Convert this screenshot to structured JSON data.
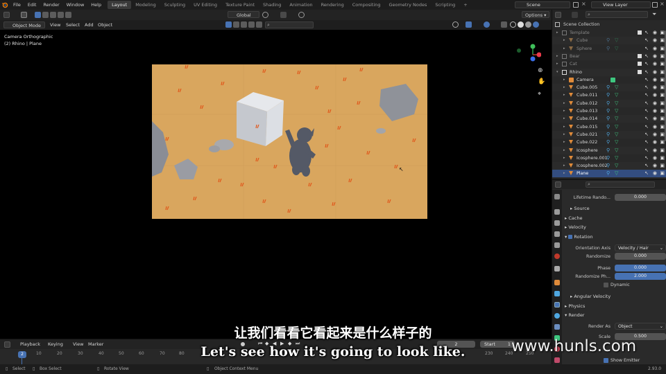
{
  "topbar": {
    "menus": [
      "File",
      "Edit",
      "Render",
      "Window",
      "Help"
    ],
    "workspaces": [
      "Layout",
      "Modeling",
      "Sculpting",
      "UV Editing",
      "Texture Paint",
      "Shading",
      "Animation",
      "Rendering",
      "Compositing",
      "Geometry Nodes",
      "Scripting"
    ],
    "active_workspace": "Layout",
    "scene": "Scene",
    "view_layer": "View Layer"
  },
  "viewport_header": {
    "mode": "Object Mode",
    "menus": [
      "View",
      "Select",
      "Add",
      "Object"
    ],
    "transform_orientation": "Global",
    "options": "Options"
  },
  "viewport": {
    "camera_label": "Camera Orthographic",
    "object_label": "(2) Rhino | Plane"
  },
  "outliner": {
    "title": "Scene Collection",
    "rows": [
      {
        "name": "Template",
        "level": 1,
        "type": "collection",
        "dim": true
      },
      {
        "name": "Cube",
        "level": 2,
        "type": "mesh",
        "dim": true
      },
      {
        "name": "Sphere",
        "level": 2,
        "type": "mesh",
        "dim": true
      },
      {
        "name": "Bear",
        "level": 1,
        "type": "collection",
        "dim": true
      },
      {
        "name": "Cat",
        "level": 1,
        "type": "collection",
        "dim": true
      },
      {
        "name": "Rhino",
        "level": 1,
        "type": "collection",
        "dim": false
      },
      {
        "name": "Camera",
        "level": 2,
        "type": "camera",
        "dim": false
      },
      {
        "name": "Cube.005",
        "level": 2,
        "type": "mesh",
        "dim": false
      },
      {
        "name": "Cube.011",
        "level": 2,
        "type": "mesh",
        "dim": false
      },
      {
        "name": "Cube.012",
        "level": 2,
        "type": "mesh",
        "dim": false
      },
      {
        "name": "Cube.013",
        "level": 2,
        "type": "mesh",
        "dim": false
      },
      {
        "name": "Cube.014",
        "level": 2,
        "type": "mesh",
        "dim": false
      },
      {
        "name": "Cube.015",
        "level": 2,
        "type": "mesh",
        "dim": false
      },
      {
        "name": "Cube.021",
        "level": 2,
        "type": "mesh",
        "dim": false
      },
      {
        "name": "Cube.022",
        "level": 2,
        "type": "mesh",
        "dim": false
      },
      {
        "name": "Icosphere",
        "level": 2,
        "type": "mesh",
        "dim": false
      },
      {
        "name": "Icosphere.001",
        "level": 2,
        "type": "mesh",
        "dim": false
      },
      {
        "name": "Icosphere.002",
        "level": 2,
        "type": "mesh",
        "dim": false
      },
      {
        "name": "Plane",
        "level": 2,
        "type": "mesh",
        "dim": false,
        "selected": true
      }
    ]
  },
  "properties": {
    "lifetime_randomness": {
      "label": "Lifetime Rando...",
      "value": "0.000"
    },
    "source": "Source",
    "cache": "Cache",
    "velocity": "Velocity",
    "rotation": "Rotation",
    "orientation_axis": {
      "label": "Orientation Axis",
      "value": "Velocity / Hair"
    },
    "randomize": {
      "label": "Randomize",
      "value": "0.000"
    },
    "phase": {
      "label": "Phase",
      "value": "0.000"
    },
    "randomize_phase": {
      "label": "Randomize Ph...",
      "value": "2.000"
    },
    "dynamic": "Dynamic",
    "angular_velocity": "Angular Velocity",
    "physics": "Physics",
    "render": "Render",
    "render_as": {
      "label": "Render As",
      "value": "Object"
    },
    "scale": {
      "label": "Scale",
      "value": "0.500"
    },
    "show_emitter": "Show Emitter"
  },
  "timeline": {
    "menus": [
      "Playback",
      "Keying",
      "View",
      "Marker"
    ],
    "current_frame": "2",
    "start_label": "Start",
    "start_value": "1",
    "ticks": [
      "2",
      "10",
      "20",
      "30",
      "40",
      "50",
      "60",
      "70",
      "80",
      "230",
      "240",
      "250"
    ]
  },
  "statusbar": {
    "select": "Select",
    "box_select": "Box Select",
    "rotate_view": "Rotate View",
    "context_menu": "Object Context Menu",
    "version": "2.93.0"
  },
  "subtitles": {
    "chinese": "让我们看看它看起来是什么样子的",
    "english": "Let's see how it's going to look like."
  },
  "watermark": "www.hunls.com",
  "colors": {
    "selected_row": "#334d80",
    "field_blue": "#4772b3",
    "ground": "#d9a65e",
    "grass": "#e0561a",
    "mesh_icon": "#e08b3a",
    "modifier_icon": "#4fa7e0",
    "particle_icon": "#3ec77f"
  }
}
